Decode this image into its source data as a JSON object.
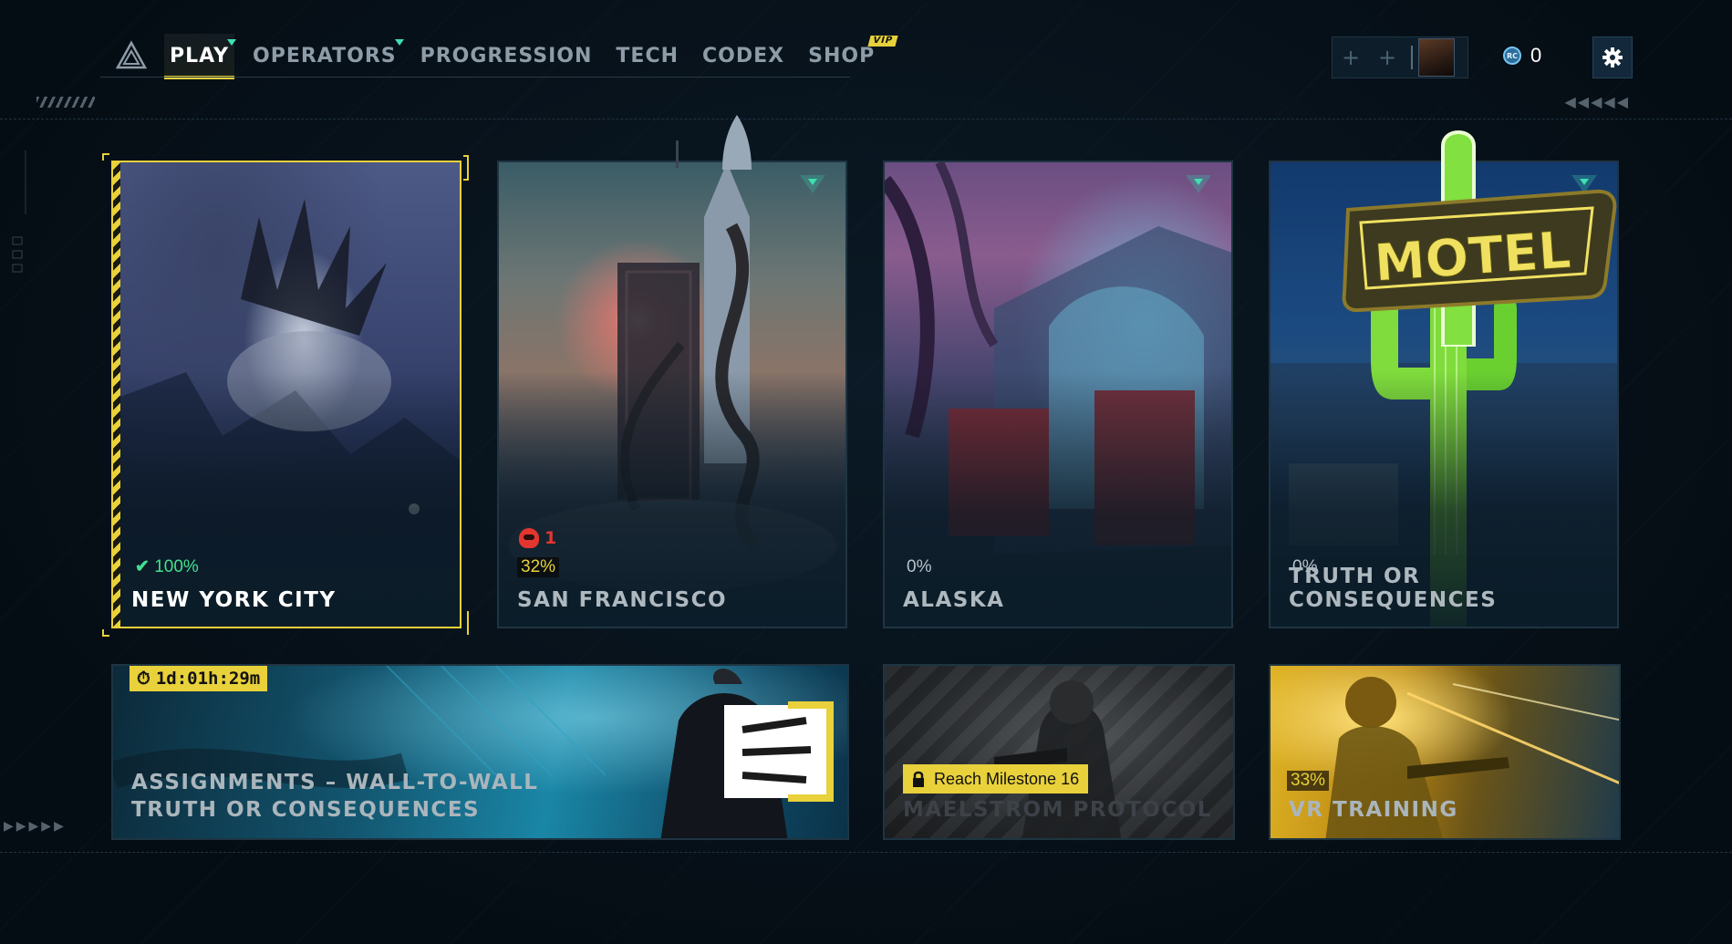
{
  "nav": {
    "tabs": [
      {
        "label": "PLAY",
        "active": true,
        "notification": true
      },
      {
        "label": "OPERATORS",
        "active": false,
        "notification": true
      },
      {
        "label": "PROGRESSION",
        "active": false,
        "notification": false
      },
      {
        "label": "TECH",
        "active": false,
        "notification": false
      },
      {
        "label": "CODEX",
        "active": false,
        "notification": false
      },
      {
        "label": "SHOP",
        "active": false,
        "notification": false,
        "badge": "VIP"
      }
    ]
  },
  "header": {
    "currency_icon": "RC",
    "currency_value": "0",
    "settings_icon": "gear-icon"
  },
  "maps": [
    {
      "name": "NEW YORK CITY",
      "progress": "100%",
      "completed": true,
      "selected": true
    },
    {
      "name": "SAN FRANCISCO",
      "progress": "32%",
      "threat_count": "1",
      "new": true
    },
    {
      "name": "ALASKA",
      "progress": "0%",
      "new": true
    },
    {
      "name": "TRUTH OR CONSEQUENCES",
      "progress": "0%",
      "new": true
    }
  ],
  "bottom": {
    "assignments": {
      "timer": "1d:01h:29m",
      "title_line1": "ASSIGNMENTS – WALL-TO-WALL",
      "title_line2": "TRUTH OR CONSEQUENCES"
    },
    "maelstrom": {
      "lock_label": "Reach Milestone 16",
      "title": "MAELSTROM PROTOCOL",
      "locked": true
    },
    "vr": {
      "progress": "33%",
      "title": "VR TRAINING"
    }
  },
  "colors": {
    "accent": "#e8d13a",
    "success": "#43e08f",
    "threat": "#e2362f",
    "notif": "#3fe0b0"
  }
}
